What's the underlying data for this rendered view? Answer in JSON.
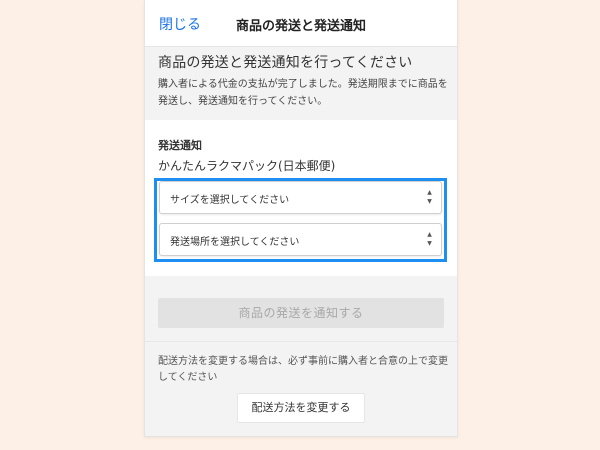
{
  "header": {
    "close_label": "閉じる",
    "title": "商品の発送と発送通知"
  },
  "intro": {
    "heading": "商品の発送と発送通知を行ってください",
    "text": "購入者による代金の支払が完了しました。発送期限までに商品を発送し、発送通知を行ってください。"
  },
  "form": {
    "section_title": "発送通知",
    "carrier": "かんたんラクマパック(日本郵便)",
    "size_select": {
      "selected": "サイズを選択してください"
    },
    "place_select": {
      "selected": "発送場所を選択してください"
    },
    "highlight_color": "#1e8ff0"
  },
  "actions": {
    "submit_label": "商品の発送を通知する",
    "submit_disabled": true
  },
  "footer": {
    "note": "配送方法を変更する場合は、必ず事前に購入者と合意の上で変更してください",
    "change_button_label": "配送方法を変更する"
  },
  "icons": {
    "select_arrows": "updown-arrows-icon"
  },
  "colors": {
    "background": "#fdf0e6",
    "link": "#1a73e8",
    "disabled_button": "#e2e2e2"
  }
}
